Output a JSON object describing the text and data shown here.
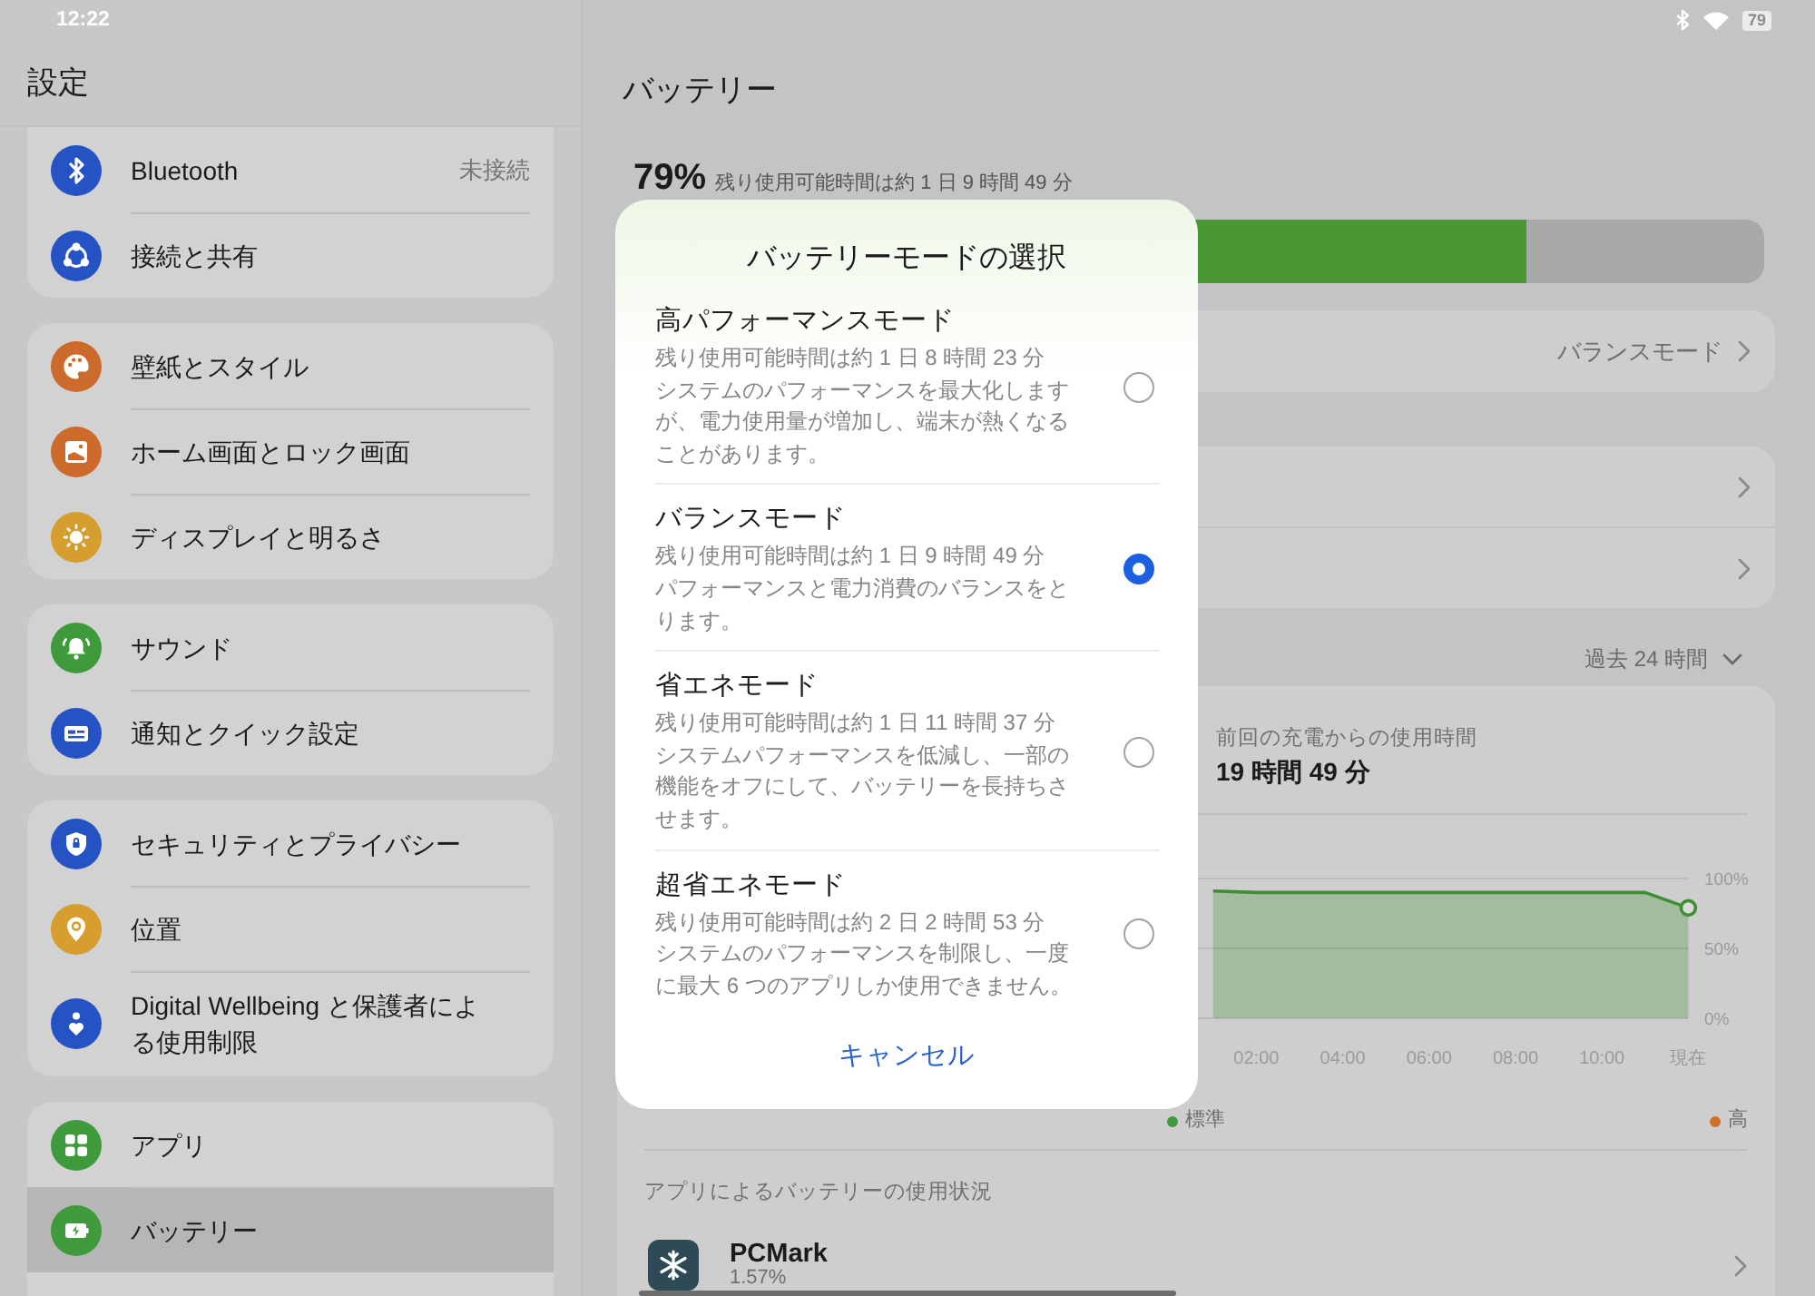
{
  "status_bar": {
    "time": "12:22",
    "battery": "79"
  },
  "sidebar": {
    "title": "設定",
    "groups": [
      {
        "items": [
          {
            "label": "Bluetooth",
            "value": "未接続",
            "selected": false
          },
          {
            "label": "接続と共有",
            "selected": false
          }
        ]
      },
      {
        "items": [
          {
            "label": "壁紙とスタイル",
            "selected": false
          },
          {
            "label": "ホーム画面とロック画面",
            "selected": false
          },
          {
            "label": "ディスプレイと明るさ",
            "selected": false
          }
        ]
      },
      {
        "items": [
          {
            "label": "サウンド",
            "selected": false
          },
          {
            "label": "通知とクイック設定",
            "selected": false
          }
        ]
      },
      {
        "items": [
          {
            "label": "セキュリティとプライバシー",
            "selected": false
          },
          {
            "label": "位置",
            "selected": false
          },
          {
            "label": "Digital Wellbeing と保護者による使用制限",
            "selected": false
          }
        ]
      },
      {
        "items": [
          {
            "label": "アプリ",
            "selected": false
          },
          {
            "label": "バッテリー",
            "selected": true
          }
        ]
      }
    ]
  },
  "battery": {
    "title": "バッテリー",
    "percent": "79%",
    "remaining": "残り使用可能時間は約 1 日 9 時間 49 分",
    "level": 0.79,
    "mode_value": "バランスモード",
    "period": "過去 24 時間",
    "usage": {
      "label": "前回の充電からの使用時間",
      "value": "19 時間 49 分"
    },
    "chart_data": {
      "type": "area",
      "x": [
        1,
        2,
        4,
        6,
        8,
        10,
        11,
        12
      ],
      "series": [
        {
          "color": "#3e8f33",
          "values": [
            91,
            90,
            90,
            90,
            90,
            90,
            90,
            79
          ]
        }
      ],
      "xlim": [
        0,
        12
      ],
      "ylim": [
        0,
        100
      ],
      "xticks": [
        {
          "value": 2,
          "label": "02:00"
        },
        {
          "value": 4,
          "label": "04:00"
        },
        {
          "value": 6,
          "label": "06:00"
        },
        {
          "value": 8,
          "label": "08:00"
        },
        {
          "value": 10,
          "label": "10:00"
        },
        {
          "value": 12,
          "label": "現在"
        }
      ],
      "yticks": [
        {
          "value": 0,
          "label": "0%"
        },
        {
          "value": 50,
          "label": "50%"
        },
        {
          "value": 100,
          "label": "100%"
        }
      ]
    },
    "legend": [
      {
        "label": "標準",
        "color": "#3e9a3b"
      },
      {
        "label": "高",
        "color": "#d0702a"
      }
    ],
    "apps_heading": "アプリによるバッテリーの使用状況",
    "apps": [
      {
        "name": "PCMark",
        "percent": "1.57%"
      }
    ]
  },
  "dialog": {
    "title": "バッテリーモードの選択",
    "options": [
      {
        "title": "高パフォーマンスモード",
        "remaining": "残り使用可能時間は約 1 日 8 時間 23 分",
        "description": "システムのパフォーマンスを最大化しますが、電力使用量が増加し、端末が熱くなることがあります。",
        "selected": false
      },
      {
        "title": "バランスモード",
        "remaining": "残り使用可能時間は約 1 日 9 時間 49 分",
        "description": "パフォーマンスと電力消費のバランスをとります。",
        "selected": true
      },
      {
        "title": "省エネモード",
        "remaining": "残り使用可能時間は約 1 日 11 時間 37 分",
        "description": "システムパフォーマンスを低減し、一部の機能をオフにして、バッテリーを長持ちさせます。",
        "selected": false
      },
      {
        "title": "超省エネモード",
        "remaining": "残り使用可能時間は約 2 日 2 時間 53 分",
        "description": "システムのパフォーマンスを制限し、一度に最大 6 つのアプリしか使用できません。",
        "selected": false
      }
    ],
    "cancel": "キャンセル"
  }
}
